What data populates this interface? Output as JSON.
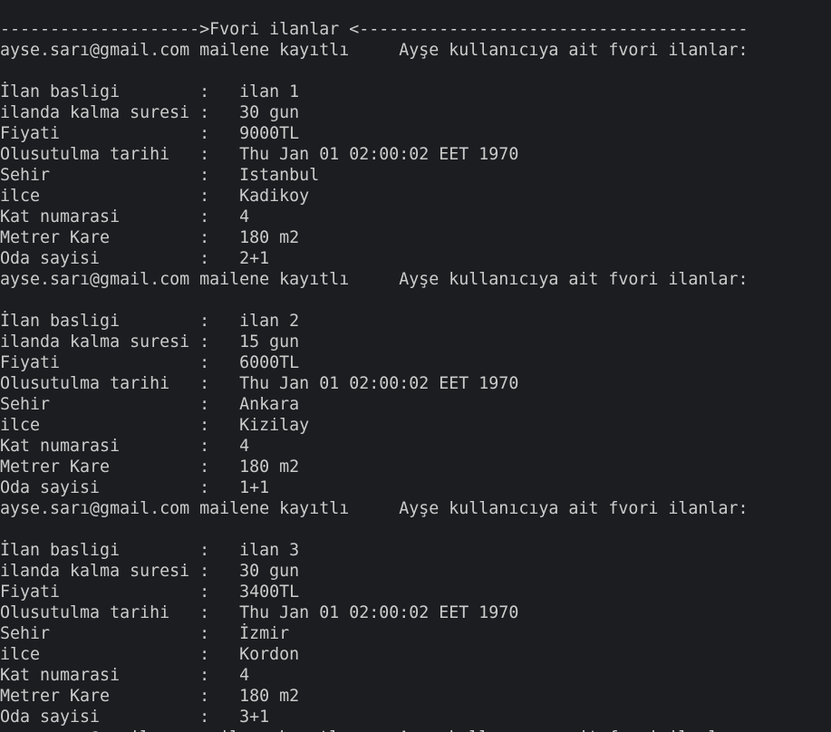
{
  "terminal": {
    "background": "#1b1d20",
    "foreground": "#cccccc",
    "lines": [
      "-------------------->Fvori ilanlar <---------------------------------------",
      "ayse.sarı@gmail.com mailene kayıtlı     Ayşe kullanıcıya ait fvori ilanlar:",
      "",
      "İlan basligi        :   ilan 1",
      "ilanda kalma suresi :   30 gun",
      "Fiyati              :   9000TL",
      "Olusutulma tarihi   :   Thu Jan 01 02:00:02 EET 1970",
      "Sehir               :   Istanbul",
      "ilce                :   Kadikoy",
      "Kat numarasi        :   4",
      "Metrer Kare         :   180 m2",
      "Oda sayisi          :   2+1",
      "ayse.sarı@gmail.com mailene kayıtlı     Ayşe kullanıcıya ait fvori ilanlar:",
      "",
      "İlan basligi        :   ilan 2",
      "ilanda kalma suresi :   15 gun",
      "Fiyati              :   6000TL",
      "Olusutulma tarihi   :   Thu Jan 01 02:00:02 EET 1970",
      "Sehir               :   Ankara",
      "ilce                :   Kizilay",
      "Kat numarasi        :   4",
      "Metrer Kare         :   180 m2",
      "Oda sayisi          :   1+1",
      "ayse.sarı@gmail.com mailene kayıtlı     Ayşe kullanıcıya ait fvori ilanlar:",
      "",
      "İlan basligi        :   ilan 3",
      "ilanda kalma suresi :   30 gun",
      "Fiyati              :   3400TL",
      "Olusutulma tarihi   :   Thu Jan 01 02:00:02 EET 1970",
      "Sehir               :   İzmir",
      "ilce                :   Kordon",
      "Kat numarasi        :   4",
      "Metrer Kare         :   180 m2",
      "Oda sayisi          :   3+1",
      "ayse.sarı@gmail.com mailene kayıtlı     Ayşe kullanıcıya ait fvori ilanlar:"
    ]
  }
}
